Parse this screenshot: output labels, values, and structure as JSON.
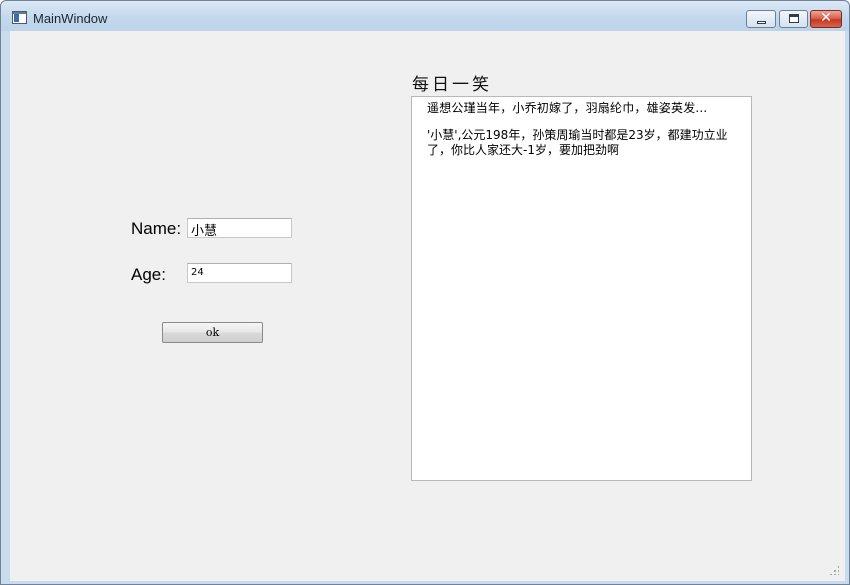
{
  "window": {
    "title": "MainWindow"
  },
  "form": {
    "name_label": "Name:",
    "name_value": "小慧",
    "age_label": "Age:",
    "age_value": "24",
    "ok_label": "ok"
  },
  "joke": {
    "heading": "每日一笑",
    "line1": "遥想公瑾当年，小乔初嫁了，羽扇纶巾，雄姿英发...",
    "line2": "'小慧',公元198年，孙策周瑜当时都是23岁，都建功立业了，你比人家还大-1岁，要加把劲啊"
  },
  "icons": {
    "app": "window-app-icon",
    "minimize": "minimize-icon",
    "maximize": "maximize-icon",
    "close": "close-icon"
  }
}
